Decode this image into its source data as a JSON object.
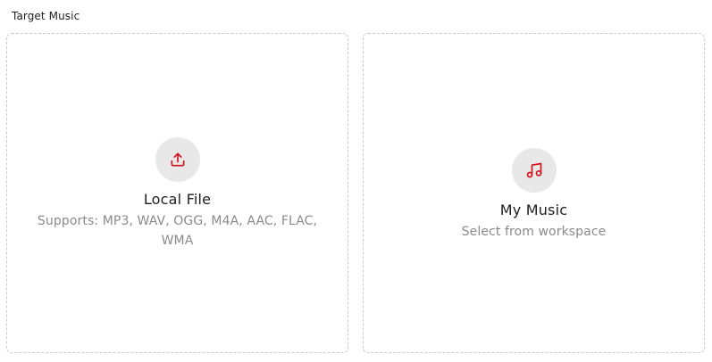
{
  "section": {
    "label": "Target Music"
  },
  "options": [
    {
      "title": "Local File",
      "subtitle": "Supports: MP3, WAV, OGG, M4A, AAC, FLAC, WMA",
      "icon": "upload-icon"
    },
    {
      "title": "My Music",
      "subtitle": "Select from workspace",
      "icon": "music-note-icon"
    }
  ],
  "colors": {
    "accent": "#d0121b",
    "icon_bg": "#e8e8e8",
    "border": "#c9c9c9",
    "muted_text": "#8a8a8a"
  }
}
